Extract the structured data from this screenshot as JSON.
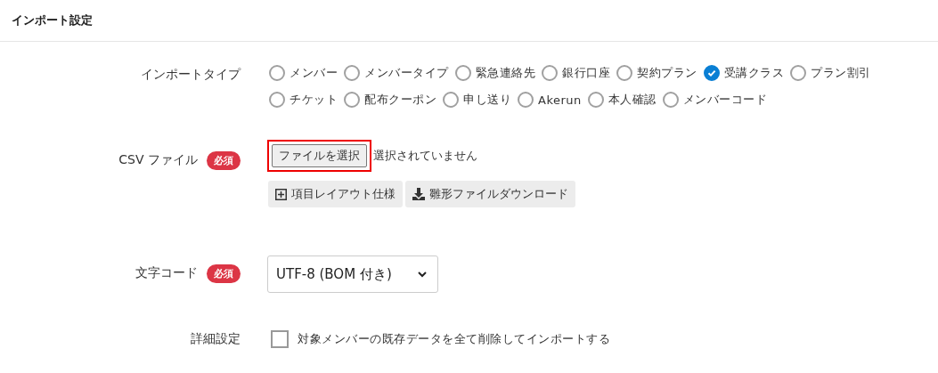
{
  "header": {
    "title": "インポート設定"
  },
  "import_type": {
    "label": "インポートタイプ",
    "options": [
      {
        "label": "メンバー",
        "selected": false
      },
      {
        "label": "メンバータイプ",
        "selected": false
      },
      {
        "label": "緊急連絡先",
        "selected": false
      },
      {
        "label": "銀行口座",
        "selected": false
      },
      {
        "label": "契約プラン",
        "selected": false
      },
      {
        "label": "受講クラス",
        "selected": true
      },
      {
        "label": "プラン割引",
        "selected": false
      },
      {
        "label": "チケット",
        "selected": false
      },
      {
        "label": "配布クーポン",
        "selected": false
      },
      {
        "label": "申し送り",
        "selected": false
      },
      {
        "label": "Akerun",
        "selected": false
      },
      {
        "label": "本人確認",
        "selected": false
      },
      {
        "label": "メンバーコード",
        "selected": false
      }
    ]
  },
  "csv_file": {
    "label": "CSV ファイル",
    "badge": "必須",
    "button": "ファイルを選択",
    "highlighted": true,
    "status": "選択されていません",
    "links": [
      {
        "kind": "layout",
        "label": "項目レイアウト仕様"
      },
      {
        "kind": "download",
        "label": "雛形ファイルダウンロード"
      }
    ]
  },
  "encoding": {
    "label": "文字コード",
    "badge": "必須",
    "value": "UTF-8 (BOM 付き)"
  },
  "advanced": {
    "label": "詳細設定",
    "checkbox": {
      "label": "対象メンバーの既存データを全て削除してインポートする",
      "checked": false
    }
  }
}
